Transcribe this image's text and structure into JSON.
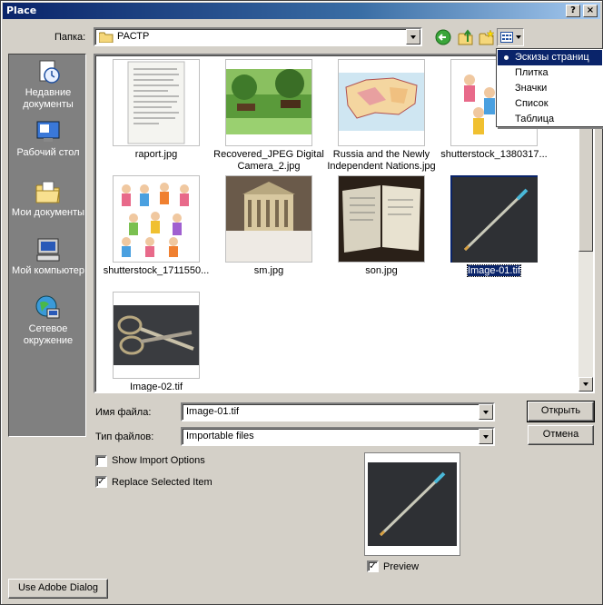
{
  "window": {
    "title": "Place"
  },
  "titlebar": {
    "help_glyph": "?",
    "close_glyph": "×"
  },
  "toolbar": {
    "folder_label": "Папка:",
    "folder_value": "РАСТР",
    "back_icon": "back-arrow-icon",
    "up_icon": "up-folder-icon",
    "new_folder_icon": "new-folder-icon",
    "view_menu_icon": "view-menu-icon"
  },
  "view_menu": {
    "items": [
      "Эскизы страниц",
      "Плитка",
      "Значки",
      "Список",
      "Таблица"
    ],
    "selected": "Эскизы страниц"
  },
  "places": {
    "items": [
      {
        "label": "Недавние документы",
        "icon": "recent-documents-icon"
      },
      {
        "label": "Рабочий стол",
        "icon": "desktop-icon"
      },
      {
        "label": "Мои документы",
        "icon": "my-documents-icon"
      },
      {
        "label": "Мой компьютер",
        "icon": "my-computer-icon"
      },
      {
        "label": "Сетевое окружение",
        "icon": "network-icon"
      }
    ]
  },
  "files": [
    {
      "name": "raport.jpg",
      "thumb": "handwritten-page"
    },
    {
      "name": "Recovered_JPEG Digital Camera_2.jpg",
      "thumb": "horses-field"
    },
    {
      "name": "Russia and the Newly Independent Nations.jpg",
      "thumb": "map"
    },
    {
      "name": "shutterstock_1380317...",
      "thumb": "kids-standing"
    },
    {
      "name": "shutterstock_1711550...",
      "thumb": "kids-group"
    },
    {
      "name": "sm.jpg",
      "thumb": "building"
    },
    {
      "name": "son.jpg",
      "thumb": "book"
    },
    {
      "name": "Image-01.tif",
      "thumb": "pen",
      "selected": true
    },
    {
      "name": "Image-02.tif",
      "thumb": "scissors"
    }
  ],
  "form": {
    "filename_label": "Имя файла:",
    "filename_value": "Image-01.tif",
    "filetype_label": "Тип файлов:",
    "filetype_value": "Importable files"
  },
  "buttons": {
    "open": "Открыть",
    "cancel": "Отмена",
    "use_adobe": "Use Adobe Dialog"
  },
  "options": {
    "show_import": {
      "label": "Show Import Options",
      "checked": false
    },
    "replace_selected": {
      "label": "Replace Selected Item",
      "checked": true
    },
    "preview": {
      "label": "Preview",
      "checked": true
    }
  },
  "check_glyph": "✓",
  "colors": {
    "selection": "#0a246a",
    "dialog_bg": "#d4d0c8",
    "places_bg": "#808080"
  }
}
